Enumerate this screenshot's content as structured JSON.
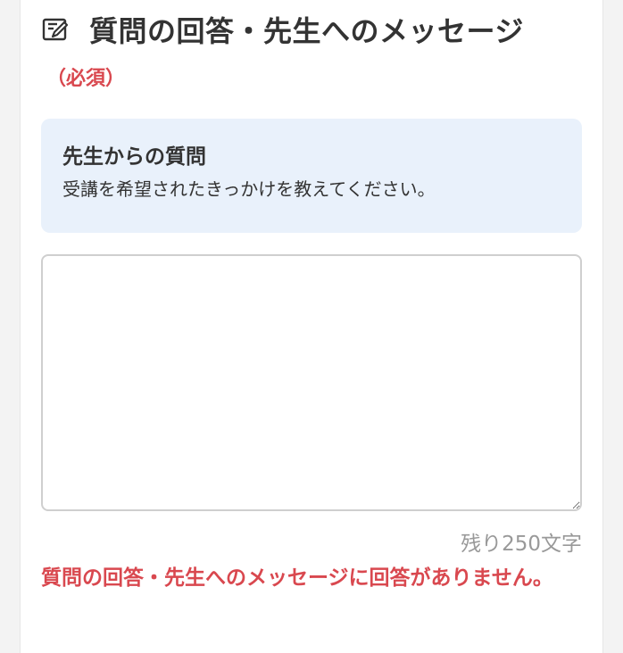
{
  "header": {
    "icon": "edit-message-icon",
    "title": "質問の回答・先生へのメッセージ"
  },
  "required_label": "（必須）",
  "question": {
    "heading": "先生からの質問",
    "text": "受講を希望されたきっかけを教えてください。"
  },
  "answer": {
    "value": "",
    "placeholder": ""
  },
  "counter_text": "残り250文字",
  "error_text": "質問の回答・先生へのメッセージに回答がありません。",
  "colors": {
    "error": "#d9484f",
    "question_bg": "#e9f1fb",
    "text": "#333333",
    "muted": "#999999"
  }
}
